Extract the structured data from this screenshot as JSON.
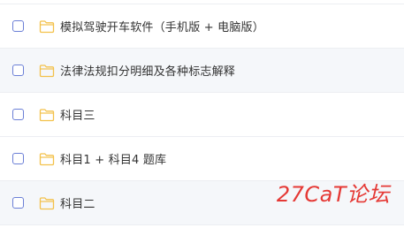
{
  "files": [
    {
      "name": "模拟驾驶开车软件（手机版 + 电脑版）",
      "icon": "folder-icon",
      "alt": false
    },
    {
      "name": "法律法规扣分明细及各种标志解释",
      "icon": "folder-icon",
      "alt": true
    },
    {
      "name": "科目三",
      "icon": "folder-icon",
      "alt": false
    },
    {
      "name": "科目1 + 科目4  题库",
      "icon": "folder-icon",
      "alt": false
    },
    {
      "name": "科目二",
      "icon": "folder-icon",
      "alt": true
    }
  ],
  "watermark": "27CaT论坛",
  "colors": {
    "checkbox_border": "#6b7fd6",
    "folder": "#f3c14a",
    "text": "#333333",
    "watermark": "#e53935"
  }
}
